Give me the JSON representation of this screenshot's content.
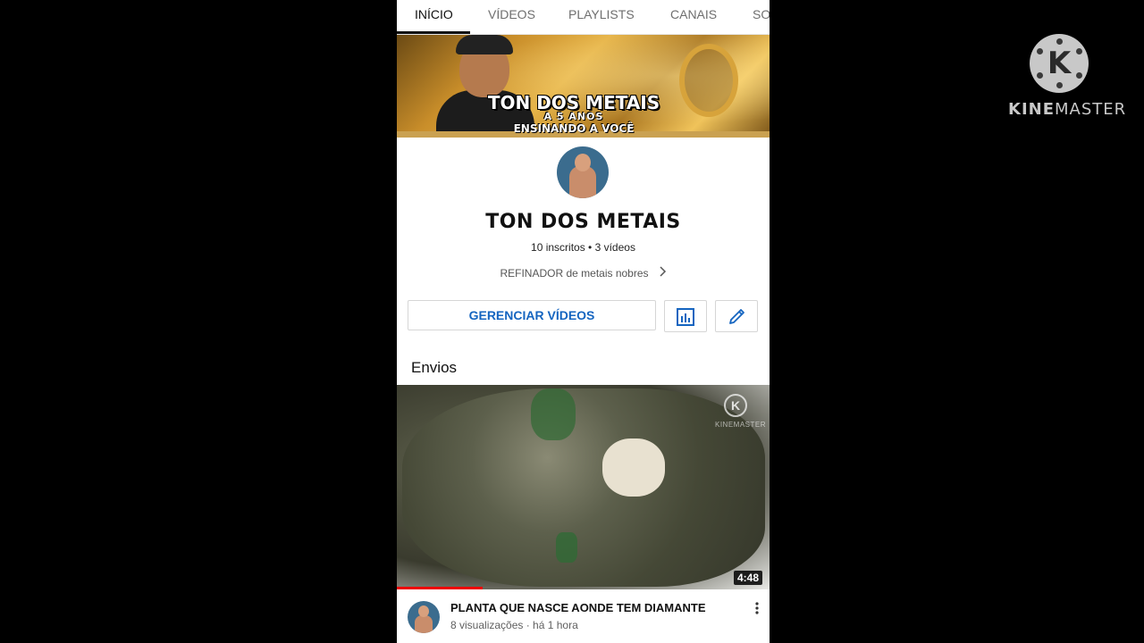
{
  "watermark": {
    "brand_prefix": "KINE",
    "brand_suffix": "MASTER",
    "logo_letter": "K"
  },
  "tabs": [
    {
      "label": "INÍCIO",
      "active": true
    },
    {
      "label": "VÍDEOS",
      "active": false
    },
    {
      "label": "PLAYLISTS",
      "active": false
    },
    {
      "label": "CANAIS",
      "active": false
    },
    {
      "label": "SO",
      "active": false
    }
  ],
  "banner": {
    "title": "TON DOS METAIS",
    "line2": "A 5 ANOS",
    "line3": "ENSINANDO A VOCÊ"
  },
  "channel": {
    "name": "TON DOS METAIS",
    "stats": "10 inscritos • 3 vídeos",
    "description": "REFINADOR de metais nobres"
  },
  "actions": {
    "manage_label": "GERENCIAR VÍDEOS",
    "analytics_icon": "bar-chart-icon",
    "edit_icon": "pencil-icon"
  },
  "section": {
    "title": "Envios"
  },
  "video": {
    "title": "PLANTA QUE NASCE AONDE TEM DIAMANTE",
    "meta": "8 visualizações · há 1 hora",
    "duration": "4:48",
    "progress": 0.23,
    "thumb_watermark": "KINEMASTER"
  },
  "colors": {
    "accent_blue": "#1565c0",
    "progress_red": "#ee0000"
  }
}
